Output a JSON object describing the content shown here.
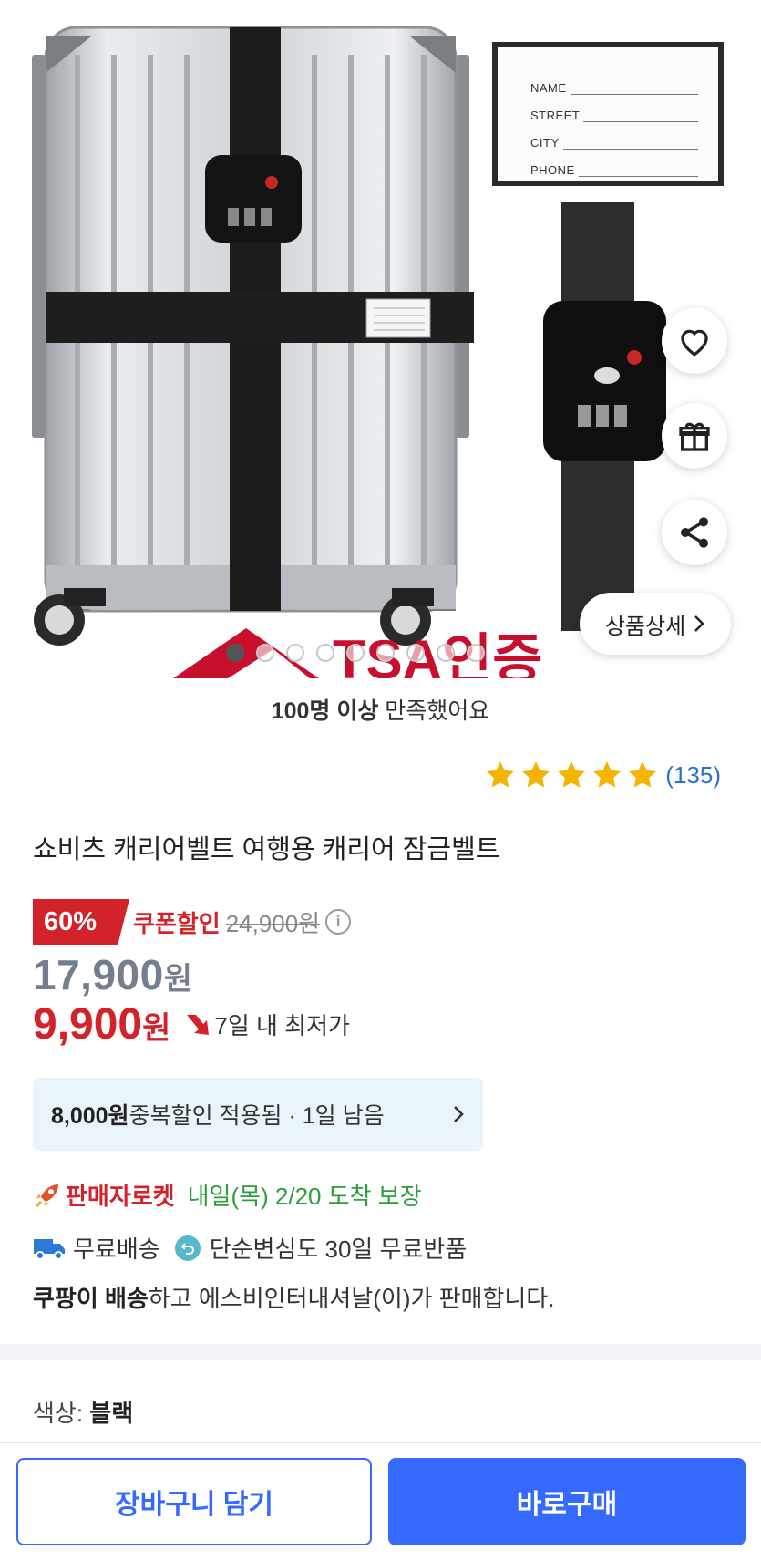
{
  "gallery": {
    "tag_fields": [
      "NAME",
      "STREET",
      "CITY",
      "PHONE"
    ],
    "brand_text": "TSA인증",
    "image_count": 9,
    "active_index": 0,
    "detail_button": "상품상세"
  },
  "satisfaction": {
    "bold": "100명 이상",
    "rest": " 만족했어요"
  },
  "rating": {
    "stars": 5,
    "count": "(135)",
    "star_color": "#f4b400"
  },
  "product": {
    "title": "쇼비츠 캐리어벨트 여행용 캐리어 잠금벨트"
  },
  "price": {
    "discount": "60%",
    "coupon_label": "쿠폰할인",
    "original": "24,900원",
    "sale_amount": "17,900",
    "sale_unit": "원",
    "final_amount": "9,900",
    "final_unit": "원",
    "lowest_label": "7일 내 최저가",
    "accent_color": "#d3222a"
  },
  "extra_discount": {
    "amount": "8,000원",
    "text": " 중복할인 적용됨 · 1일 남음"
  },
  "delivery": {
    "rocket_label": "판매자로켓",
    "arrival": "내일(목) 2/20 도착 보장",
    "free_shipping": "무료배송",
    "free_return": "단순변심도 30일 무료반품"
  },
  "seller": {
    "bold": "쿠팡이 배송",
    "rest": "하고 에스비인터내셔날(이)가 판매합니다."
  },
  "option": {
    "label": "색상: ",
    "value": "블랙"
  },
  "actions": {
    "cart": "장바구니 담기",
    "buy": "바로구매",
    "brand_color": "#346aff"
  }
}
